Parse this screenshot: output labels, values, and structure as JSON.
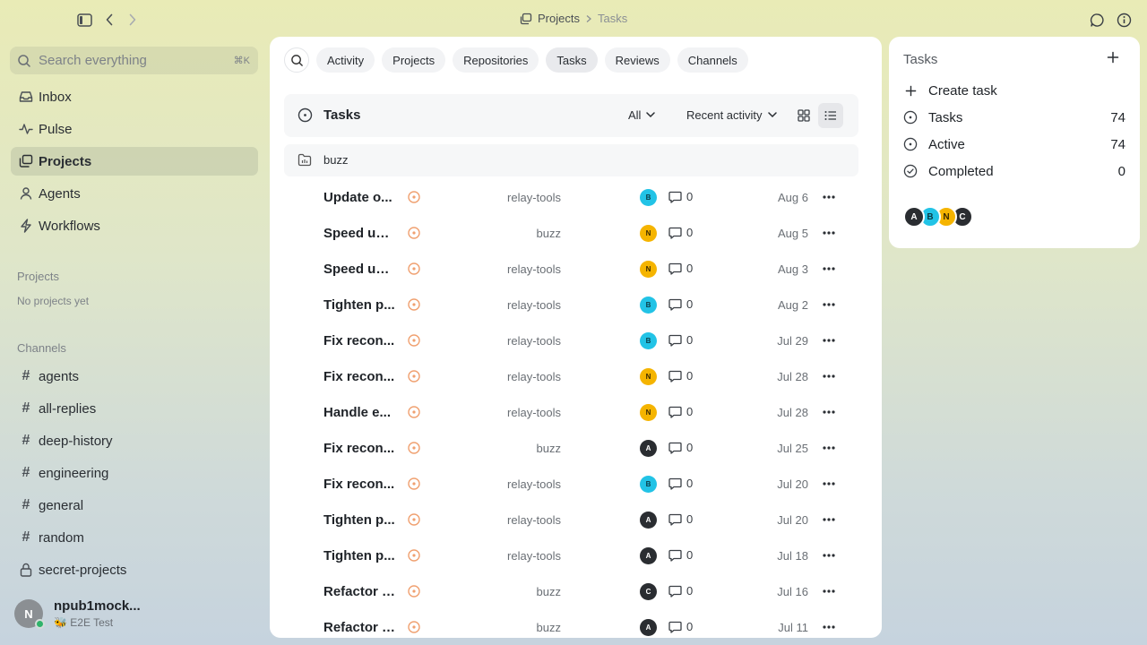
{
  "breadcrumb": {
    "parent": "Projects",
    "current": "Tasks"
  },
  "search": {
    "placeholder": "Search everything",
    "shortcut": "⌘K"
  },
  "nav": [
    {
      "label": "Inbox",
      "icon": "inbox-icon",
      "active": false
    },
    {
      "label": "Pulse",
      "icon": "pulse-icon",
      "active": false
    },
    {
      "label": "Projects",
      "icon": "projects-icon",
      "active": true
    },
    {
      "label": "Agents",
      "icon": "agents-icon",
      "active": false
    },
    {
      "label": "Workflows",
      "icon": "workflows-icon",
      "active": false
    }
  ],
  "projects_section": {
    "label": "Projects",
    "empty": "No projects yet"
  },
  "channels_section": {
    "label": "Channels",
    "items": [
      "agents",
      "all-replies",
      "deep-history",
      "engineering",
      "general",
      "random",
      "secret-projects"
    ]
  },
  "user": {
    "initial": "N",
    "name": "npub1mock...",
    "subtitle": "🐝 E2E Test"
  },
  "filters": [
    "Activity",
    "Projects",
    "Repositories",
    "Tasks",
    "Reviews",
    "Channels"
  ],
  "active_filter": "Tasks",
  "tasks_header": {
    "title": "Tasks",
    "scope": "All",
    "sort": "Recent activity"
  },
  "group": {
    "label": "buzz"
  },
  "tasks": [
    {
      "title": "Update o...",
      "project": "relay-tools",
      "assignee": "B",
      "comments": "0",
      "date": "Aug 6"
    },
    {
      "title": "Speed up ...",
      "project": "buzz",
      "assignee": "N",
      "comments": "0",
      "date": "Aug 5"
    },
    {
      "title": "Speed up ...",
      "project": "relay-tools",
      "assignee": "N",
      "comments": "0",
      "date": "Aug 3"
    },
    {
      "title": "Tighten p...",
      "project": "relay-tools",
      "assignee": "B",
      "comments": "0",
      "date": "Aug 2"
    },
    {
      "title": "Fix recon...",
      "project": "relay-tools",
      "assignee": "B",
      "comments": "0",
      "date": "Jul 29"
    },
    {
      "title": "Fix recon...",
      "project": "relay-tools",
      "assignee": "N",
      "comments": "0",
      "date": "Jul 28"
    },
    {
      "title": "Handle e...",
      "project": "relay-tools",
      "assignee": "N",
      "comments": "0",
      "date": "Jul 28"
    },
    {
      "title": "Fix recon...",
      "project": "buzz",
      "assignee": "A",
      "comments": "0",
      "date": "Jul 25"
    },
    {
      "title": "Fix recon...",
      "project": "relay-tools",
      "assignee": "B",
      "comments": "0",
      "date": "Jul 20"
    },
    {
      "title": "Tighten p...",
      "project": "relay-tools",
      "assignee": "A",
      "comments": "0",
      "date": "Jul 20"
    },
    {
      "title": "Tighten p...",
      "project": "relay-tools",
      "assignee": "A",
      "comments": "0",
      "date": "Jul 18"
    },
    {
      "title": "Refactor f...",
      "project": "buzz",
      "assignee": "C",
      "comments": "0",
      "date": "Jul 16"
    },
    {
      "title": "Refactor f...",
      "project": "buzz",
      "assignee": "A",
      "comments": "0",
      "date": "Jul 11"
    }
  ],
  "avatar_colors": {
    "A": {
      "bg": "#2a2d31",
      "fg": "#ffffff"
    },
    "B": {
      "bg": "#22c3e6",
      "fg": "#0b3a45"
    },
    "N": {
      "bg": "#f5b400",
      "fg": "#3a2a00"
    },
    "C": {
      "bg": "#2a2d31",
      "fg": "#ffffff"
    }
  },
  "status_color": "#f0a070",
  "panel": {
    "title": "Tasks",
    "create_label": "Create task",
    "stats": [
      {
        "label": "Tasks",
        "value": "74",
        "icon": "circle-dot-icon"
      },
      {
        "label": "Active",
        "value": "74",
        "icon": "circle-dot-icon"
      },
      {
        "label": "Completed",
        "value": "0",
        "icon": "circle-check-icon"
      }
    ],
    "people": [
      "A",
      "B",
      "N",
      "C"
    ]
  }
}
